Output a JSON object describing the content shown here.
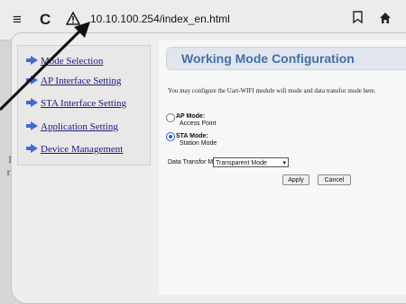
{
  "browser": {
    "url": "10.10.100.254/index_en.html",
    "icons": [
      "menu-icon",
      "reload-icon",
      "warning-icon",
      "bookmark-icon",
      "home-icon",
      "more-icon"
    ]
  },
  "side_text": [
    "1",
    "r."
  ],
  "sidebar": {
    "items": [
      {
        "label": "Mode Selection"
      },
      {
        "label": "AP Interface Setting"
      },
      {
        "label": "STA Interface Setting"
      },
      {
        "label": "Application Setting"
      },
      {
        "label": "Device Management"
      }
    ]
  },
  "main": {
    "title": "Working Mode Configuration",
    "description": "You may configure the Uart-WIFI module wifi mode and data transfor mode here.",
    "modes": [
      {
        "label": "AP Mode:",
        "sub": "Access Point",
        "selected": false
      },
      {
        "label": "STA Mode:",
        "sub": "Station Mode",
        "selected": true
      }
    ],
    "data_transfer_label": "Data Transfor Mode",
    "data_transfer_value": "Transparent Mode",
    "apply_label": "Apply",
    "cancel_label": "Cancel"
  },
  "colors": {
    "title": "#426fa9",
    "nav_link": "#1a1a80",
    "nav_arrow": "#3d6bd3"
  }
}
